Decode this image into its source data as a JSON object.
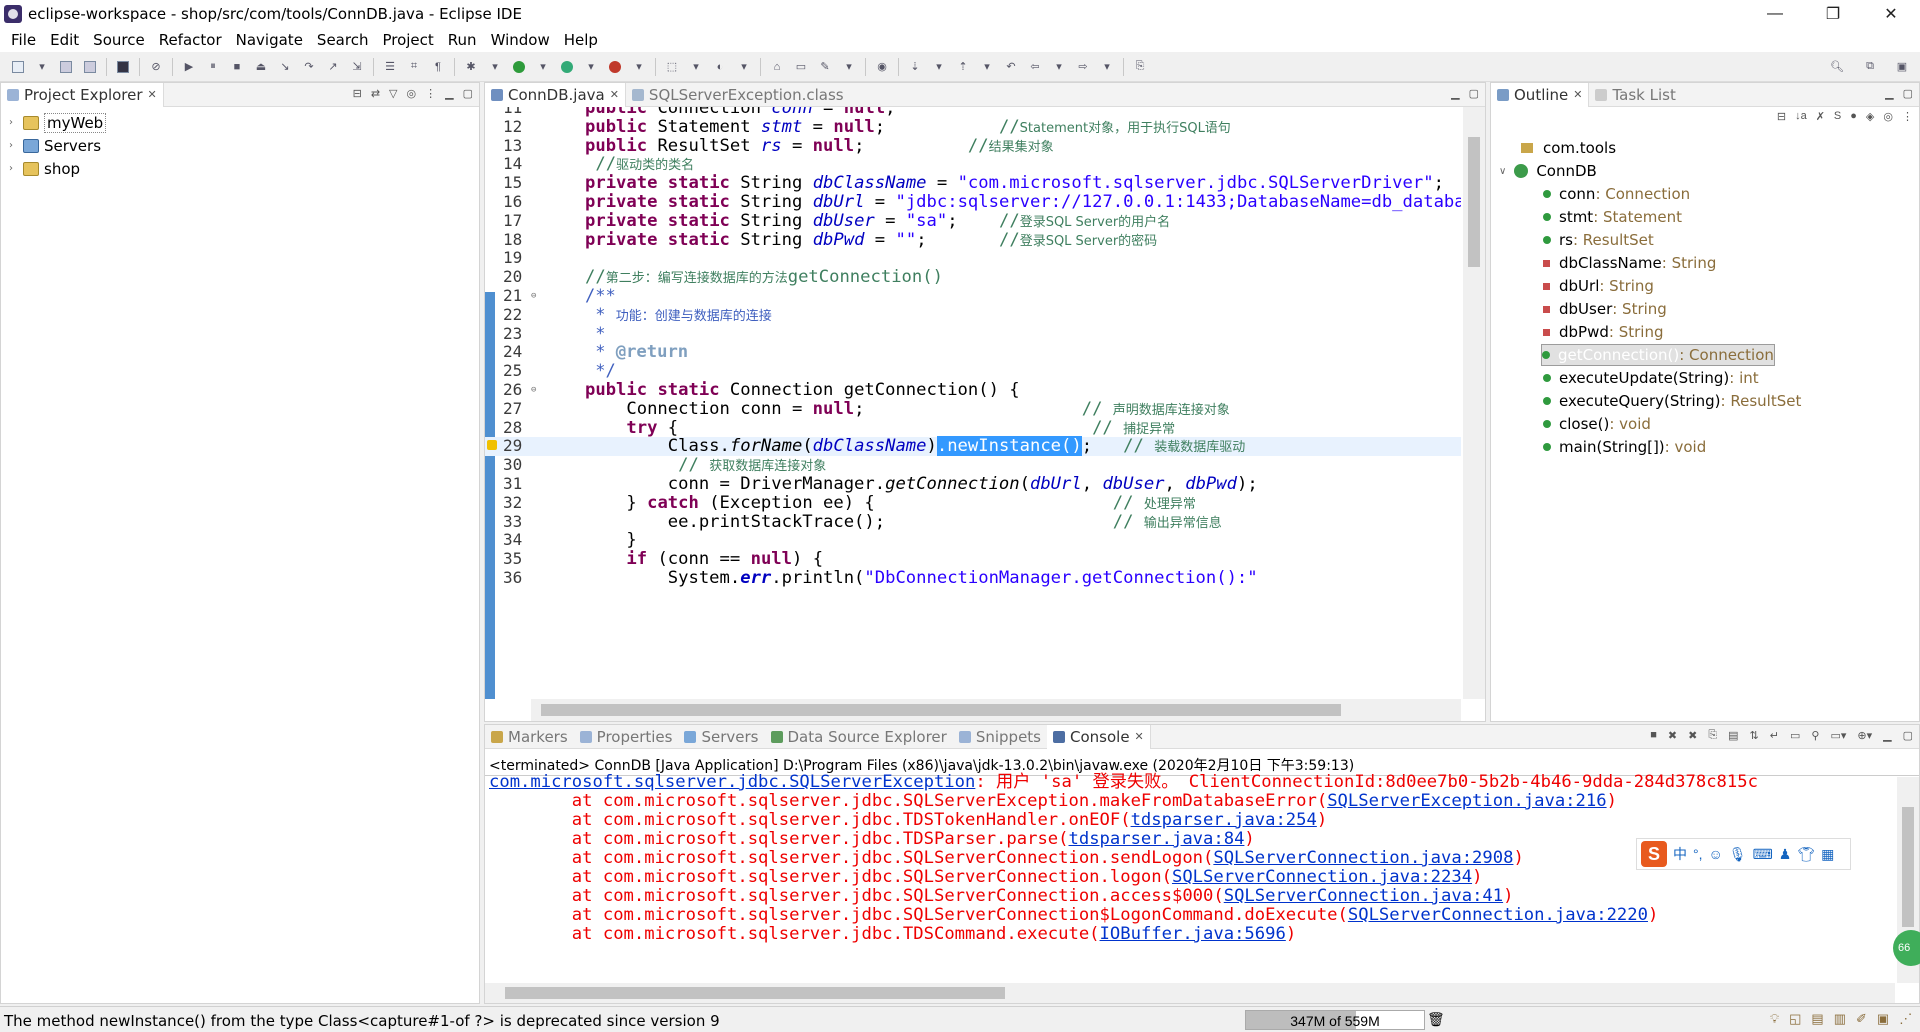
{
  "window": {
    "title": "eclipse-workspace - shop/src/com/tools/ConnDB.java - Eclipse IDE",
    "min": "—",
    "max": "❐",
    "close": "✕"
  },
  "menu": [
    "File",
    "Edit",
    "Source",
    "Refactor",
    "Navigate",
    "Search",
    "Project",
    "Run",
    "Window",
    "Help"
  ],
  "explorer": {
    "tab": "Project Explorer",
    "items": [
      {
        "label": "myWeb"
      },
      {
        "label": "Servers"
      },
      {
        "label": "shop"
      }
    ]
  },
  "editor": {
    "tabs": [
      {
        "label": "ConnDB.java"
      },
      {
        "label": "SQLServerException.class"
      }
    ],
    "lines": [
      {
        "n": "11",
        "h": "<span class='kw'>public</span> Connection <span class='fld'>conn</span> = <span class='kw'>null</span>;"
      },
      {
        "n": "12",
        "h": "<span class='kw'>public</span> Statement <span class='fld'>stmt</span> = <span class='kw'>null</span>;           <span class='cmm'>//</span><span class='cm'>Statement对象，用于执行SQL语句</span>"
      },
      {
        "n": "13",
        "h": "<span class='kw'>public</span> ResultSet <span class='fld'>rs</span> = <span class='kw'>null</span>;          <span class='cmm'>//</span><span class='cm'>结果集对象</span>"
      },
      {
        "n": "14",
        "h": " <span class='cmm'>//</span><span class='cm'>驱动类的类名</span>"
      },
      {
        "n": "15",
        "h": "<span class='kw'>private</span> <span class='kw'>static</span> String <span class='sfld'>dbClassName</span> = <span class='str'>\"com.microsoft.sqlserver.jdbc.SQLServerDriver\"</span>;"
      },
      {
        "n": "16",
        "h": "<span class='kw'>private</span> <span class='kw'>static</span> String <span class='sfld'>dbUrl</span> = <span class='str'>\"jdbc:sqlserver://127.0.0.1:1433;DatabaseName=db_database\"</span>;"
      },
      {
        "n": "17",
        "h": "<span class='kw'>private</span> <span class='kw'>static</span> String <span class='sfld'>dbUser</span> = <span class='str'>\"sa\"</span>;    <span class='cmm'>//</span><span class='cm'>登录SQL Server的用户名</span>"
      },
      {
        "n": "18",
        "h": "<span class='kw'>private</span> <span class='kw'>static</span> String <span class='sfld'>dbPwd</span> = <span class='str'>\"\"</span>;       <span class='cmm'>//</span><span class='cm'>登录SQL Server的密码</span>"
      },
      {
        "n": "19",
        "h": ""
      },
      {
        "n": "20",
        "h": "<span class='cmm'>//</span><span class='cm'>第二步：编写连接数据库的方法</span><span class='cmm'>getConnection()</span>"
      },
      {
        "n": "21",
        "h": "<span class='jd' style='font-family:DejaVu Sans Mono,monospace;font-size:17px'>/**</span>"
      },
      {
        "n": "22",
        "h": "<span class='jd' style='font-family:DejaVu Sans Mono,monospace;font-size:17px'> * </span><span class='jd'>功能：创建与数据库的连接</span>"
      },
      {
        "n": "23",
        "h": "<span class='jd' style='font-family:DejaVu Sans Mono,monospace;font-size:17px'> *</span>"
      },
      {
        "n": "24",
        "h": "<span class='jd' style='font-family:DejaVu Sans Mono,monospace;font-size:17px'> * </span><span class='jdt'>@return</span>"
      },
      {
        "n": "25",
        "h": "<span class='jd' style='font-family:DejaVu Sans Mono,monospace;font-size:17px'> */</span>"
      },
      {
        "n": "26",
        "h": "<span class='kw'>public</span> <span class='kw'>static</span> Connection getConnection() {"
      },
      {
        "n": "27",
        "h": "    Connection conn = <span class='kw'>null</span>;                     <span class='cmm'>// </span><span class='cm'>声明数据库连接对象</span>"
      },
      {
        "n": "28",
        "h": "    <span class='kw'>try</span> {                                        <span class='cmm'>// </span><span class='cm'>捕捉异常</span>"
      },
      {
        "n": "29",
        "h": "        Class.<span class='mth'>forName</span>(<span class='sfld'>dbClassName</span>)<span class='sel'>.newInstance()</span>;   <span class='cmm'>// </span><span class='cm'>装载数据库驱动</span>"
      },
      {
        "n": "30",
        "h": "         <span class='cmm'>// </span><span class='cm'>获取数据库连接对象</span>"
      },
      {
        "n": "31",
        "h": "        conn = DriverManager.<span class='mth'>getConnection</span>(<span class='sfld'>dbUrl</span>, <span class='sfld'>dbUser</span>, <span class='sfld'>dbPwd</span>);"
      },
      {
        "n": "32",
        "h": "    } <span class='kw'>catch</span> (Exception ee) {                       <span class='cmm'>// </span><span class='cm'>处理异常</span>"
      },
      {
        "n": "33",
        "h": "        ee.printStackTrace();                      <span class='cmm'>// </span><span class='cm'>输出异常信息</span>"
      },
      {
        "n": "34",
        "h": "    }"
      },
      {
        "n": "35",
        "h": "    <span class='kw'>if</span> (conn == <span class='kw'>null</span>) {"
      },
      {
        "n": "36",
        "h": "        System.<span class='sfld' style='font-weight:bold'>err</span>.println(<span class='str'>\"DbConnectionManager.getConnection():\"</span>"
      }
    ]
  },
  "outline": {
    "tab": "Outline",
    "tab2": "Task List",
    "package": "com.tools",
    "class": "ConnDB",
    "members": [
      {
        "name": "conn",
        "type": " : Connection",
        "kind": "pub"
      },
      {
        "name": "stmt",
        "type": " : Statement",
        "kind": "pub"
      },
      {
        "name": "rs",
        "type": " : ResultSet",
        "kind": "pub"
      },
      {
        "name": "dbClassName",
        "type": " : String",
        "kind": "priv"
      },
      {
        "name": "dbUrl",
        "type": " : String",
        "kind": "priv"
      },
      {
        "name": "dbUser",
        "type": " : String",
        "kind": "priv"
      },
      {
        "name": "dbPwd",
        "type": " : String",
        "kind": "priv"
      },
      {
        "name": "getConnection()",
        "type": " : Connection",
        "kind": "sel"
      },
      {
        "name": "executeUpdate(String)",
        "type": " : int",
        "kind": "pub"
      },
      {
        "name": "executeQuery(String)",
        "type": " : ResultSet",
        "kind": "pub"
      },
      {
        "name": "close()",
        "type": " : void",
        "kind": "pub"
      },
      {
        "name": "main(String[])",
        "type": " : void",
        "kind": "pub"
      }
    ]
  },
  "bottom": {
    "tabs": [
      {
        "label": "Markers"
      },
      {
        "label": "Properties"
      },
      {
        "label": "Servers"
      },
      {
        "label": "Data Source Explorer"
      },
      {
        "label": "Snippets"
      },
      {
        "label": "Console"
      }
    ],
    "terminated": "<terminated> ConnDB [Java Application] D:\\Program Files (x86)\\java\\jdk-13.0.2\\bin\\javaw.exe (2020年2月10日 下午3:59:13)",
    "lines": [
      {
        "h": "<span class='link'>com.microsoft.sqlserver.jdbc.SQLServerException</span>: 用户 'sa' 登录失败。 ClientConnectionId:8d0ee7b0-5b2b-4b46-9dda-284d378c815c"
      },
      {
        "h": "\tat com.microsoft.sqlserver.jdbc.SQLServerException.makeFromDatabaseError(<span class='link'>SQLServerException.java:216</span>)"
      },
      {
        "h": "\tat com.microsoft.sqlserver.jdbc.TDSTokenHandler.onEOF(<span class='link'>tdsparser.java:254</span>)"
      },
      {
        "h": "\tat com.microsoft.sqlserver.jdbc.TDSParser.parse(<span class='link'>tdsparser.java:84</span>)"
      },
      {
        "h": "\tat com.microsoft.sqlserver.jdbc.SQLServerConnection.sendLogon(<span class='link'>SQLServerConnection.java:2908</span>)"
      },
      {
        "h": "\tat com.microsoft.sqlserver.jdbc.SQLServerConnection.logon(<span class='link'>SQLServerConnection.java:2234</span>)"
      },
      {
        "h": "\tat com.microsoft.sqlserver.jdbc.SQLServerConnection.access$000(<span class='link'>SQLServerConnection.java:41</span>)"
      },
      {
        "h": "\tat com.microsoft.sqlserver.jdbc.SQLServerConnection$LogonCommand.doExecute(<span class='link'>SQLServerConnection.java:2220</span>)"
      },
      {
        "h": "\tat com.microsoft.sqlserver.jdbc.TDSCommand.execute(<span class='link'>IOBuffer.java:5696</span>)"
      }
    ]
  },
  "status": {
    "message": "The method newInstance() from the type Class<capture#1-of ?> is deprecated since version 9",
    "memory": "347M of 559M",
    "memory_used_fraction": 0.62
  },
  "ime": {
    "s": "S",
    "zh": "中",
    "punct": "°,"
  },
  "badge": "66"
}
